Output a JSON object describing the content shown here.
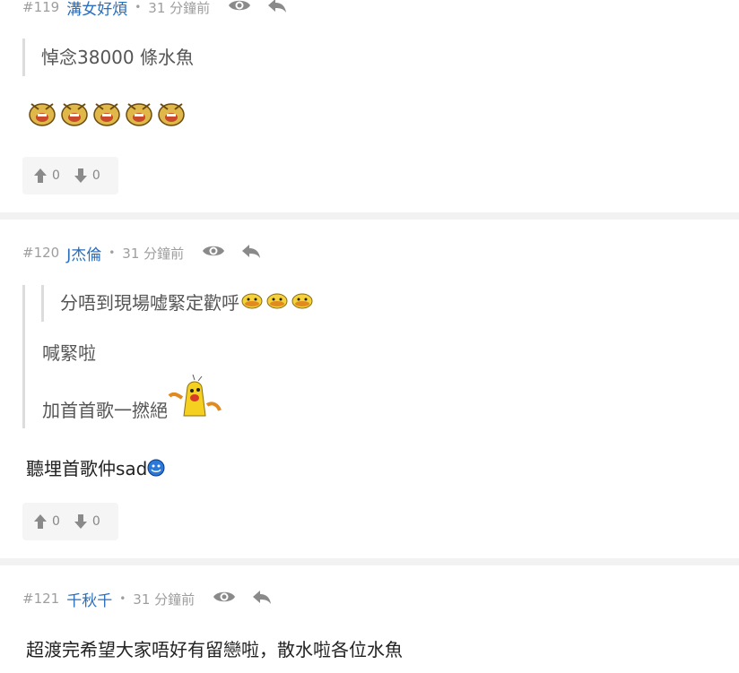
{
  "posts": [
    {
      "number": "#119",
      "user": "溝女好煩",
      "dot": "•",
      "time": "31 分鐘前",
      "quote": "悼念38000 條水魚",
      "upvotes": "0",
      "downvotes": "0"
    },
    {
      "number": "#120",
      "user": "J杰倫",
      "dot": "•",
      "time": "31 分鐘前",
      "nested_quote": "分唔到現場嘘緊定歡呼",
      "quote_line1": "喊緊啦",
      "quote_line2": "加首首歌一撚絕",
      "body": "聽埋首歌仲sad",
      "upvotes": "0",
      "downvotes": "0"
    },
    {
      "number": "#121",
      "user": "千秋千",
      "dot": "•",
      "time": "31 分鐘前",
      "body": "超渡完希望大家唔好有留戀啦，散水啦各位水魚"
    }
  ],
  "colors": {
    "username": "#2a6ebb",
    "meta": "#9e9e9e",
    "separator": "#f2f2f2"
  }
}
